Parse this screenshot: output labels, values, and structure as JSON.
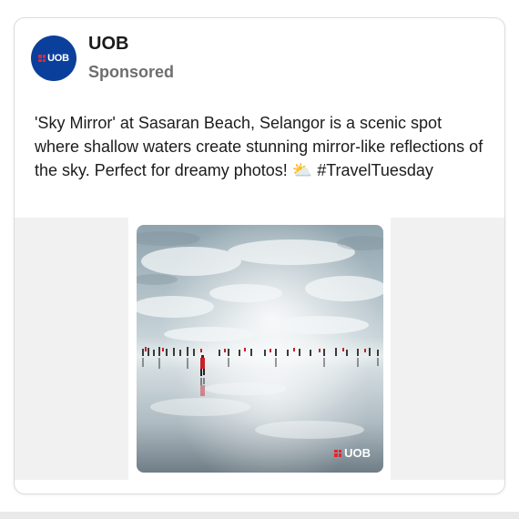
{
  "post": {
    "account_name": "UOB",
    "sponsored_label": "Sponsored",
    "avatar_logo_text": "UOB",
    "caption": "'Sky Mirror' at Sasaran Beach, Selangor is a scenic spot where shallow waters create stunning mirror-like reflections of the sky. Perfect for dreamy photos! ⛅ #TravelTuesday",
    "image_watermark": "UOB"
  },
  "colors": {
    "brand_blue": "#0b3f9c",
    "brand_red": "#e3262f"
  },
  "icons": {
    "avatar": "uob-logo-icon",
    "watermark": "uob-logo-icon",
    "emoji": "sun-behind-cloud-icon"
  }
}
